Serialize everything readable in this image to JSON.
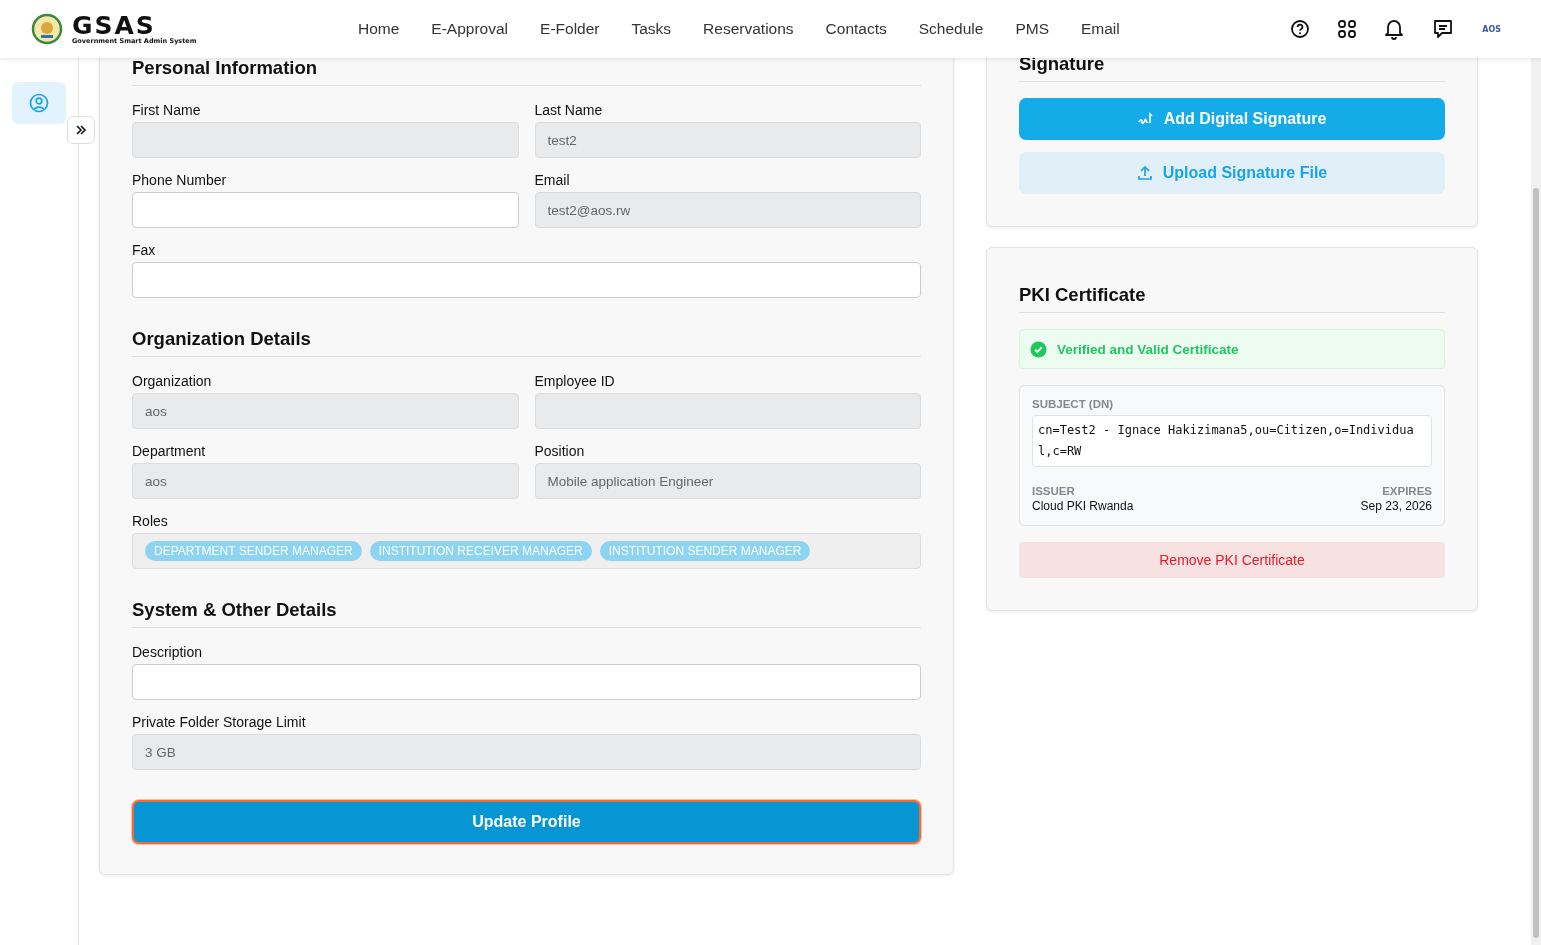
{
  "header": {
    "logo_title": "GSAS",
    "logo_subtitle": "Government Smart Admin System",
    "nav": [
      {
        "label": "Home"
      },
      {
        "label": "E-Approval"
      },
      {
        "label": "E-Folder"
      },
      {
        "label": "Tasks"
      },
      {
        "label": "Reservations"
      },
      {
        "label": "Contacts"
      },
      {
        "label": "Schedule"
      },
      {
        "label": "PMS"
      },
      {
        "label": "Email"
      }
    ],
    "avatar_text": "AOS"
  },
  "sidebar": {
    "items": [
      {
        "selected": true
      }
    ]
  },
  "sections": [
    {
      "title": "Personal Information",
      "rows": [
        [
          {
            "label": "First Name",
            "disabled": true
          },
          {
            "label": "Last Name",
            "value": "test2",
            "disabled": true
          }
        ],
        [
          {
            "label": "Phone Number",
            "disabled": false
          },
          {
            "label": "Email",
            "value": "test2@aos.rw",
            "disabled": true
          }
        ],
        [
          {
            "label": "Fax",
            "disabled": false
          }
        ]
      ]
    },
    {
      "title": "Organization Details",
      "rows": [
        [
          {
            "label": "Organization",
            "value": "aos",
            "disabled": true
          },
          {
            "label": "Employee ID",
            "disabled": true
          }
        ],
        [
          {
            "label": "Department",
            "value": "aos",
            "disabled": true
          },
          {
            "label": "Position",
            "value": "Mobile application Engineer",
            "disabled": true
          }
        ]
      ],
      "roles": {
        "label": "Roles",
        "items": [
          "DEPARTMENT SENDER MANAGER",
          "INSTITUTION RECEIVER MANAGER",
          "INSTITUTION SENDER MANAGER"
        ]
      }
    },
    {
      "title": "System & Other Details",
      "rows": [
        [
          {
            "label": "Description",
            "disabled": false
          }
        ],
        [
          {
            "label": "Private Folder Storage Limit",
            "value": "3 GB",
            "disabled": true
          }
        ]
      ]
    }
  ],
  "submit": "Update Profile",
  "signature": {
    "title": "Signature",
    "add": "Add Digital Signature",
    "upload": "Upload Signature File"
  },
  "pki": {
    "title": "PKI Certificate",
    "status": "Verified and Valid Certificate",
    "subject_label": "SUBJECT (DN)",
    "subject": "cn=Test2 - Ignace Hakizimana5,ou=Citizen,o=Individual,c=RW",
    "issuer_label": "ISSUER",
    "issuer": "Cloud PKI Rwanda",
    "expires_label": "EXPIRES",
    "expires": "Sep 23, 2026",
    "remove": "Remove PKI Certificate"
  }
}
